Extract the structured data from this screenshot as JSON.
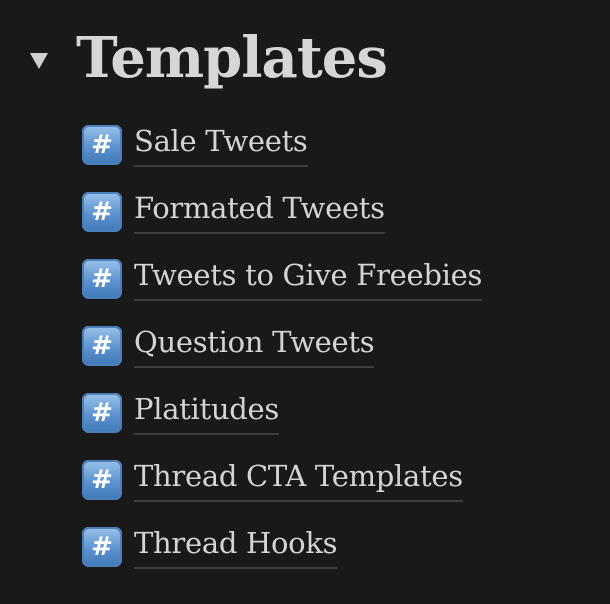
{
  "toggle": {
    "title": "Templates",
    "expanded": true
  },
  "pages": [
    {
      "icon": "#",
      "label": "Sale Tweets"
    },
    {
      "icon": "#",
      "label": "Formated Tweets"
    },
    {
      "icon": "#",
      "label": "Tweets to Give Freebies"
    },
    {
      "icon": "#",
      "label": "Question Tweets"
    },
    {
      "icon": "#",
      "label": "Platitudes"
    },
    {
      "icon": "#",
      "label": "Thread CTA Templates"
    },
    {
      "icon": "#",
      "label": "Thread Hooks"
    }
  ],
  "colors": {
    "background": "#191919",
    "text": "#d4d4d4",
    "icon_blue": "#5c93cf"
  }
}
